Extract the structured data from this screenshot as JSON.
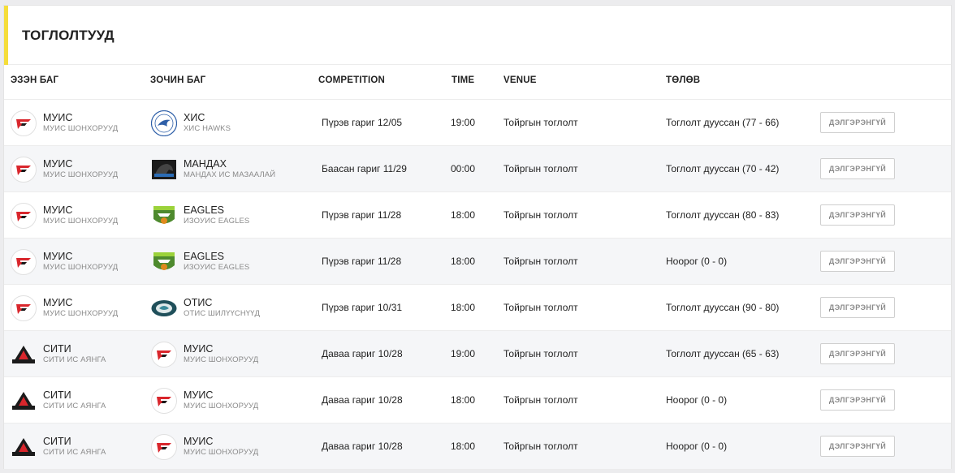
{
  "page_title": "ТОГЛОЛТУУД",
  "columns": {
    "home": "ЭЗЭН БАГ",
    "away": "ЗОЧИН БАГ",
    "competition": "COMPETITION",
    "time": "TIME",
    "venue": "VENUE",
    "status": "ТӨЛӨВ"
  },
  "details_label": "ДЭЛГЭРЭНГҮЙ",
  "rows": [
    {
      "home": {
        "name": "МУИС",
        "sub": "МУИС ШОНХОРУУД",
        "logo": "muis-logo"
      },
      "away": {
        "name": "ХИС",
        "sub": "ХИС HAWKS",
        "logo": "his-logo"
      },
      "competition": "Пүрэв гариг 12/05",
      "time": "19:00",
      "venue": "Тойргын тоглолт",
      "status": "Тоглолт дууссан (77 - 66)"
    },
    {
      "home": {
        "name": "МУИС",
        "sub": "МУИС ШОНХОРУУД",
        "logo": "muis-logo"
      },
      "away": {
        "name": "МАНДАХ",
        "sub": "МАНДАХ ИС МАЗААЛАЙ",
        "logo": "mandakh-logo"
      },
      "competition": "Баасан гариг 11/29",
      "time": "00:00",
      "venue": "Тойргын тоглолт",
      "status": "Тоглолт дууссан (70 - 42)"
    },
    {
      "home": {
        "name": "МУИС",
        "sub": "МУИС ШОНХОРУУД",
        "logo": "muis-logo"
      },
      "away": {
        "name": "EAGLES",
        "sub": "ИЗОУИС EAGLES",
        "logo": "eagles-logo"
      },
      "competition": "Пүрэв гариг 11/28",
      "time": "18:00",
      "venue": "Тойргын тоглолт",
      "status": "Тоглолт дууссан (80 - 83)"
    },
    {
      "home": {
        "name": "МУИС",
        "sub": "МУИС ШОНХОРУУД",
        "logo": "muis-logo"
      },
      "away": {
        "name": "EAGLES",
        "sub": "ИЗОУИС EAGLES",
        "logo": "eagles-logo"
      },
      "competition": "Пүрэв гариг 11/28",
      "time": "18:00",
      "venue": "Тойргын тоглолт",
      "status": "Ноорог (0 - 0)"
    },
    {
      "home": {
        "name": "МУИС",
        "sub": "МУИС ШОНХОРУУД",
        "logo": "muis-logo"
      },
      "away": {
        "name": "ОТИС",
        "sub": "ОТИС ШИЛҮҮСНҮҮД",
        "logo": "otis-logo"
      },
      "competition": "Пүрэв гариг 10/31",
      "time": "18:00",
      "venue": "Тойргын тоглолт",
      "status": "Тоглолт дууссан (90 - 80)"
    },
    {
      "home": {
        "name": "СИТИ",
        "sub": "СИТИ ИС АЯНГА",
        "logo": "city-logo"
      },
      "away": {
        "name": "МУИС",
        "sub": "МУИС ШОНХОРУУД",
        "logo": "muis-logo"
      },
      "competition": "Даваа гариг 10/28",
      "time": "19:00",
      "venue": "Тойргын тоглолт",
      "status": "Тоглолт дууссан (65 - 63)"
    },
    {
      "home": {
        "name": "СИТИ",
        "sub": "СИТИ ИС АЯНГА",
        "logo": "city-logo"
      },
      "away": {
        "name": "МУИС",
        "sub": "МУИС ШОНХОРУУД",
        "logo": "muis-logo"
      },
      "competition": "Даваа гариг 10/28",
      "time": "18:00",
      "venue": "Тойргын тоглолт",
      "status": "Ноорог (0 - 0)"
    },
    {
      "home": {
        "name": "СИТИ",
        "sub": "СИТИ ИС АЯНГА",
        "logo": "city-logo"
      },
      "away": {
        "name": "МУИС",
        "sub": "МУИС ШОНХОРУУД",
        "logo": "muis-logo"
      },
      "competition": "Даваа гариг 10/28",
      "time": "18:00",
      "venue": "Тойргын тоглолт",
      "status": "Ноорог (0 - 0)"
    }
  ],
  "colors": {
    "accent": "#f5dd3a",
    "muis_red": "#d9262c",
    "alt_row": "#f5f6f8"
  }
}
